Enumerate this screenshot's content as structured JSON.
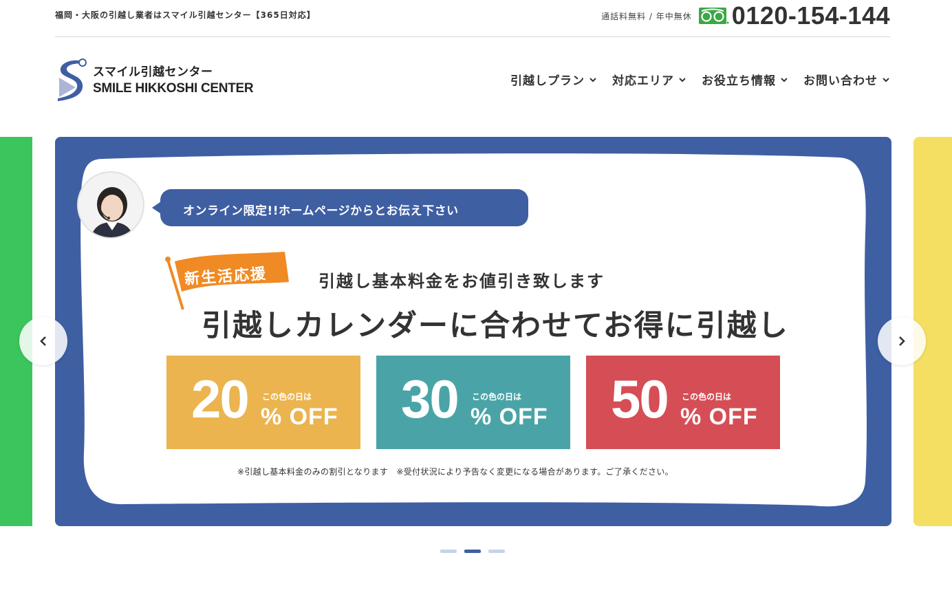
{
  "topbar": {
    "tagline": "福岡・大阪の引越し業者はスマイル引越センター【365日対応】",
    "contact_note": "通話料無料 / 年中無休",
    "phone": "0120-154-144",
    "icon": "freedial-icon"
  },
  "logo": {
    "jp": "スマイル引越センター",
    "en": "SMILE HIKKOSHI CENTER"
  },
  "nav": {
    "items": [
      {
        "label": "引越しプラン"
      },
      {
        "label": "対応エリア"
      },
      {
        "label": "お役立ち情報"
      },
      {
        "label": "お問い合わせ"
      }
    ]
  },
  "slide": {
    "bubble": "オンライン限定!!ホームページからとお伝え下さい",
    "flag": "新生活応援",
    "sub_heading": "引越し基本料金をお値引き致します",
    "main_heading": "引越しカレンダーに合わせてお得に引越し",
    "offers": [
      {
        "value": "20",
        "note": "この色の日は",
        "off": "% OFF",
        "color": "#ebb44f"
      },
      {
        "value": "30",
        "note": "この色の日は",
        "off": "% OFF",
        "color": "#4aa4a7"
      },
      {
        "value": "50",
        "note": "この色の日は",
        "off": "% OFF",
        "color": "#d54e55"
      }
    ],
    "disclaimer": "※引越し基本料金のみの割引となります　※受付状況により予告なく変更になる場合があります。ご了承ください。"
  },
  "colors": {
    "brand_blue": "#3f5fa3",
    "side_green": "#3cc55c",
    "side_yellow": "#f5df63",
    "freedial_green": "#3aa845"
  },
  "pagination": {
    "count": 3,
    "active": 2
  }
}
